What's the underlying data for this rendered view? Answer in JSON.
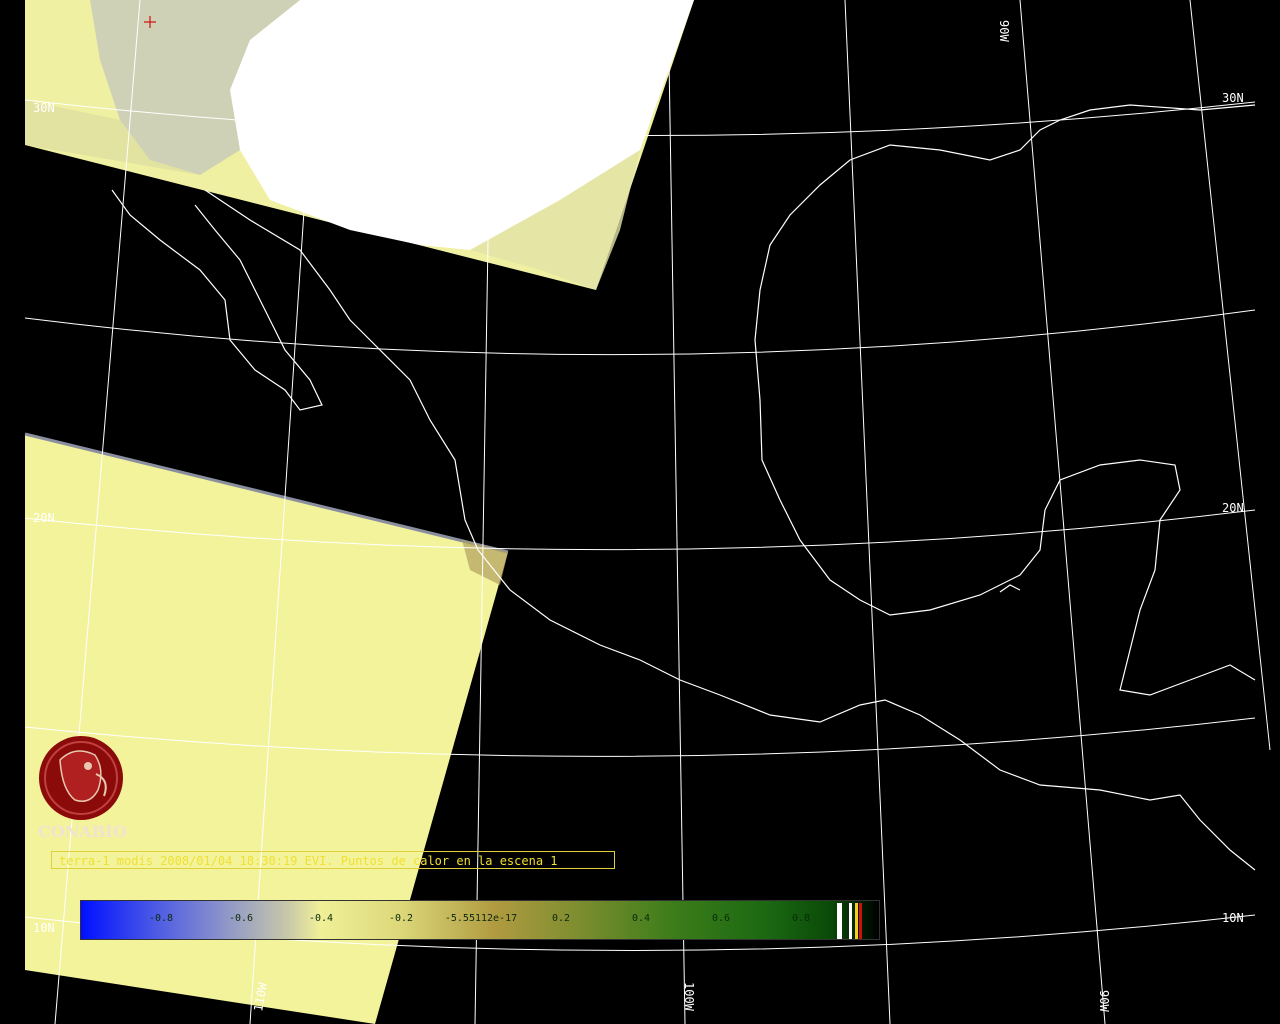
{
  "map": {
    "grid_labels": {
      "lat_30n_left": "30N",
      "lat_30n_right": "30N",
      "lat_20n_left": "20N",
      "lat_20n_right": "20N",
      "lat_10n_left": "10N",
      "lat_10n_right": "10N",
      "lon_90w_top": "90W",
      "lon_90w_bottom": "90W",
      "lon_100w_bottom": "100W",
      "lon_110w_bottom": "110W"
    },
    "colors": {
      "background": "#000000",
      "grid": "#ffffff",
      "coast": "#ffffff",
      "swath_fill": "#f3f39c",
      "hotspot_marker": "#d01010"
    }
  },
  "logo": {
    "text": "CONABIO",
    "icon": "macaw-logo-icon",
    "color": "#8b0a0a"
  },
  "caption": {
    "text": "terra-1 modis 2008/01/04 18:30:19 EVI. Puntos de calor en la escena 1"
  },
  "colorbar": {
    "ticks": [
      "-0.8",
      "-0.6",
      "-0.4",
      "-0.2",
      "-5.55112e-17",
      "0.2",
      "0.4",
      "0.6",
      "0.8"
    ],
    "stripe_colors": [
      "#ffffff",
      "#ffffff",
      "#f0d020",
      "#d01010"
    ]
  }
}
